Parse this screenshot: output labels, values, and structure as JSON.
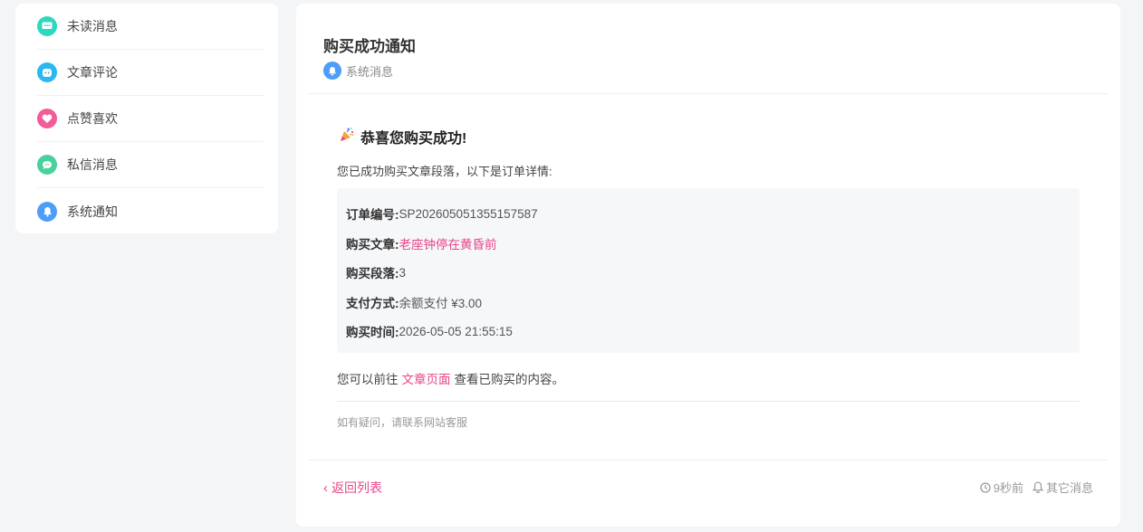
{
  "sidebar": {
    "items": [
      {
        "label": "未读消息",
        "icon": "chat-dots-icon",
        "color": "#2fd6c0"
      },
      {
        "label": "文章评论",
        "icon": "comment-bot-icon",
        "color": "#2bb8f0"
      },
      {
        "label": "点赞喜欢",
        "icon": "heart-icon",
        "color": "#f35b9a"
      },
      {
        "label": "私信消息",
        "icon": "message-bubble-icon",
        "color": "#49d19b"
      },
      {
        "label": "系统通知",
        "icon": "bell-icon",
        "color": "#4d9df9"
      }
    ]
  },
  "header": {
    "title": "购买成功通知",
    "category": "系统消息"
  },
  "message": {
    "heading": "恭喜您购买成功!",
    "intro": "您已成功购买文章段落，以下是订单详情:",
    "details": [
      {
        "key": "订单编号:",
        "value": "SP202605051355157587"
      },
      {
        "key": "购买文章:",
        "value": "老座钟停在黄昏前"
      },
      {
        "key": "购买段落:",
        "value": "3"
      },
      {
        "key": "支付方式:",
        "value": "余额支付 ¥3.00"
      },
      {
        "key": "购买时间:",
        "value": "2026-05-05 21:55:15"
      }
    ],
    "after_prefix": "您可以前往",
    "after_link": "文章页面",
    "after_suffix": "查看已购买的内容。",
    "tip": "如有疑问，请联系网站客服"
  },
  "footer": {
    "back_label": "返回列表",
    "time_ago": "9秒前",
    "other_label": "其它消息"
  },
  "colors": {
    "accent": "#e8458a",
    "system": "#4d9df9"
  }
}
